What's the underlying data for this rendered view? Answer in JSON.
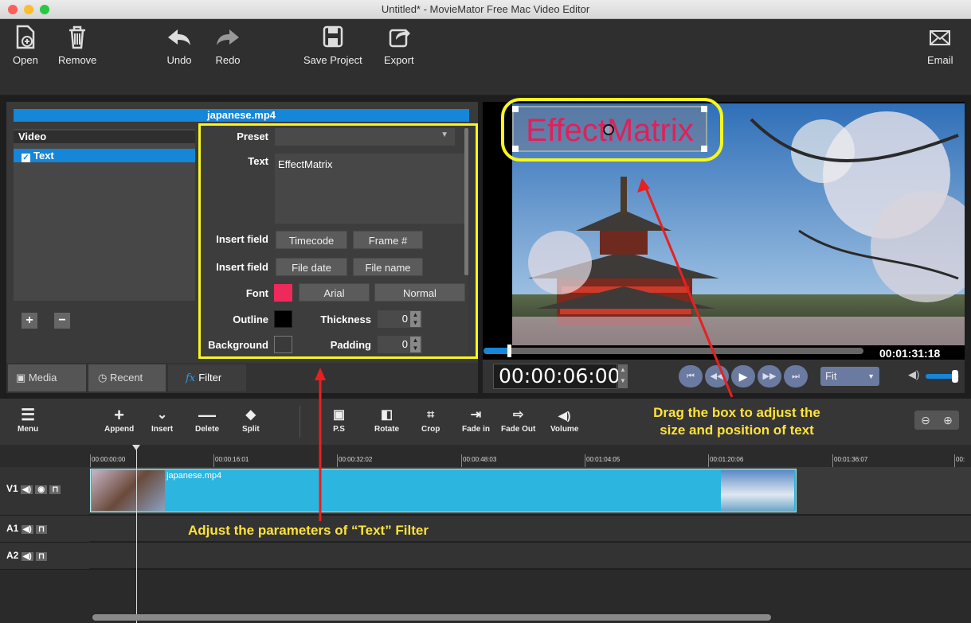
{
  "window": {
    "title": "Untitled* - MovieMator Free Mac Video Editor"
  },
  "toolbar": {
    "open": "Open",
    "remove": "Remove",
    "undo": "Undo",
    "redo": "Redo",
    "save_project": "Save Project",
    "export": "Export",
    "email": "Email"
  },
  "filter_panel": {
    "file_name": "japanese.mp4",
    "list_header": "Video",
    "list_item": "Text",
    "preset_label": "Preset",
    "preset_value": "",
    "text_label": "Text",
    "text_value": "EffectMatrix",
    "insert_field_1": "Insert field",
    "timecode_btn": "Timecode",
    "frame_btn": "Frame #",
    "insert_field_2": "Insert field",
    "file_date_btn": "File date",
    "file_name_btn": "File name",
    "font_label": "Font",
    "font_color": "#ee2a5a",
    "font_name": "Arial",
    "font_style": "Normal",
    "outline_label": "Outline",
    "outline_color": "#000000",
    "thickness_label": "Thickness",
    "thickness_value": "0",
    "background_label": "Background",
    "padding_label": "Padding",
    "padding_value": "0",
    "add_btn": "+",
    "remove_btn": "−"
  },
  "tabs": {
    "media": "Media",
    "recent": "Recent",
    "filter": "Filter"
  },
  "preview": {
    "overlay_text": "EffectMatrix",
    "duration": "00:01:31:18",
    "current_time": "00:00:06:00",
    "zoom": "Fit",
    "progress": 0.02,
    "volume": 0.85
  },
  "timeline_toolbar": {
    "menu": "Menu",
    "append": "Append",
    "insert": "Insert",
    "delete": "Delete",
    "split": "Split",
    "ps": "P.S",
    "rotate": "Rotate",
    "crop": "Crop",
    "fade_in": "Fade in",
    "fade_out": "Fade Out",
    "volume": "Volume"
  },
  "ruler": [
    "00:00:00:00",
    "00:00:16:01",
    "00:00:32:02",
    "00:00:48:03",
    "00:01:04:05",
    "00:01:20:06",
    "00:01:36:07",
    "00:"
  ],
  "tracks": {
    "v1": "V1",
    "a1": "A1",
    "a2": "A2",
    "clip_name": "japanese.mp4"
  },
  "annotations": {
    "drag": "Drag the box to adjust the\nsize and position of text",
    "adjust": "Adjust the parameters of “Text” Filter"
  },
  "colors": {
    "accent": "#1586d8",
    "highlight": "#f7f71d",
    "clip": "#2bb5df",
    "arrow": "#e82020"
  }
}
